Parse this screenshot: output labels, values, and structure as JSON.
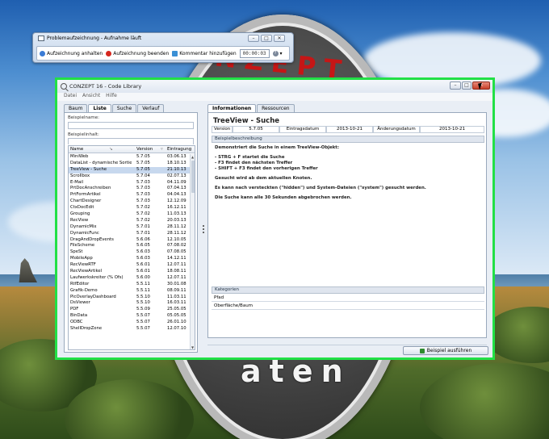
{
  "recorder": {
    "title": "Problemaufzeichnung - Aufnahme läuft",
    "pause_label": "Aufzeichnung anhalten",
    "stop_label": "Aufzeichnung beenden",
    "comment_label": "Kommentar hinzufügen",
    "timer": "00:00:03",
    "help_glyph": "?",
    "more_glyph": "▾"
  },
  "window": {
    "title": "CONZEPT 16 - Code Library",
    "minimize_glyph": "–",
    "maximize_glyph": "□",
    "close_glyph": "✕",
    "menu": [
      "Datei",
      "Ansicht",
      "Hilfe"
    ]
  },
  "left": {
    "tabs": [
      "Baum",
      "Liste",
      "Suche",
      "Verlauf"
    ],
    "active_tab": "Liste",
    "example_name_label": "Beispielname:",
    "example_content_label": "Beispielinhalt:",
    "columns": [
      "Name",
      "Version",
      "Eintragung"
    ],
    "rows": [
      [
        "MiniWeb",
        "5.7.05",
        "03.06.13"
      ],
      [
        "DataList - dynamische Sortiert",
        "5.7.05",
        "18.10.13"
      ],
      [
        "TreeView - Suche",
        "5.7.05",
        "21.10.13"
      ],
      [
        "Scrollbox",
        "5.7.04",
        "02.07.13"
      ],
      [
        "E-Mail",
        "5.7.03",
        "04.11.09"
      ],
      [
        "PrtDocAnschreiben",
        "5.7.03",
        "07.04.13"
      ],
      [
        "PrtFormArtikel",
        "5.7.03",
        "04.04.13"
      ],
      [
        "ChartDesigner",
        "5.7.03",
        "12.12.09"
      ],
      [
        "CtxDocEdit",
        "5.7.02",
        "16.12.11"
      ],
      [
        "Grouping",
        "5.7.02",
        "11.03.13"
      ],
      [
        "RecView",
        "5.7.02",
        "20.03.13"
      ],
      [
        "DynamicMix",
        "5.7.01",
        "28.11.12"
      ],
      [
        "DynamicFunc",
        "5.7.01",
        "28.11.12"
      ],
      [
        "DragAndDropEvents",
        "5.6.06",
        "12.10.05"
      ],
      [
        "FileScheme",
        "5.6.05",
        "07.08.02"
      ],
      [
        "SpeSt",
        "5.6.03",
        "07.08.05"
      ],
      [
        "MobileApp",
        "5.6.03",
        "14.12.11"
      ],
      [
        "RecViewRTF",
        "5.6.01",
        "12.07.11"
      ],
      [
        "RecViewArtikel",
        "5.6.01",
        "18.08.11"
      ],
      [
        "Laufwerkskreiter (% Ofs)",
        "5.6.00",
        "12.07.11"
      ],
      [
        "RtfEditor",
        "5.5.11",
        "30.01.08"
      ],
      [
        "Grafik-Demo",
        "5.5.11",
        "08.09.11"
      ],
      [
        "PicOverlayDashboard",
        "5.5.10",
        "11.03.11"
      ],
      [
        "DsViewer",
        "5.5.10",
        "16.03.11"
      ],
      [
        "PDF",
        "5.5.09",
        "25.05.05"
      ],
      [
        "BinData",
        "5.5.07",
        "05.05.05"
      ],
      [
        "ODBC",
        "5.5.07",
        "26.01.10"
      ],
      [
        "ShellDropZone",
        "5.5.07",
        "12.07.10"
      ]
    ],
    "selected_row": 2
  },
  "right": {
    "tabs": [
      "Informationen",
      "Ressourcen"
    ],
    "active_tab": "Informationen",
    "title": "TreeView - Suche",
    "version_label": "Version",
    "version_value": "5.7.05",
    "entry_label": "Eintragsdatum",
    "entry_value": "2013-10-21",
    "change_label": "Änderungsdatum",
    "change_value": "2013-10-21",
    "desc_header": "Beispielbeschreibung",
    "desc_lines": [
      "Demonstriert die Suche in einem TreeView-Objekt:",
      "",
      "- STRG + F startet die Suche",
      "- F3 findet den nächsten Treffer",
      "- SHIFT + F3 findet den vorherigen Treffer",
      "",
      "Gesucht wird ab dem aktuellen Knoten.",
      "",
      "Es kann nach versteckten (\"hidden\") und System-Dateien (\"system\") gesucht werden.",
      "",
      "Die Suche kann alle 30 Sekunden abgebrochen werden."
    ],
    "categories_header": "Kategorien",
    "path_label": "Pfad",
    "path_value": "Oberfläche/Baum"
  },
  "run_button": "Beispiel ausführen",
  "colors": {
    "window_border": "#22e046",
    "selection": "#c7d8ee",
    "logo_red": "#c51616"
  }
}
